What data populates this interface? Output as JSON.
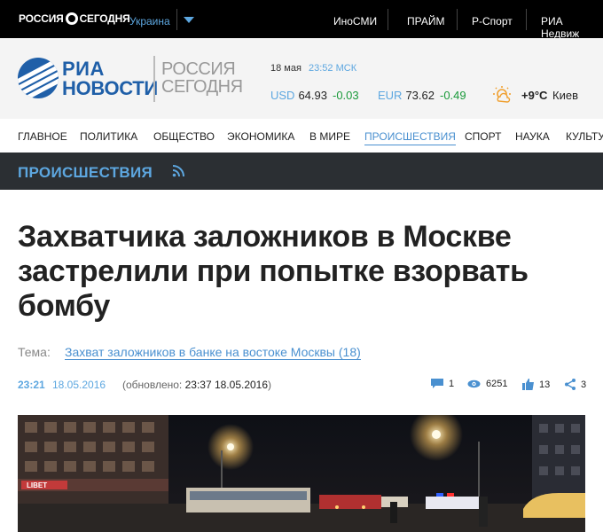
{
  "topbar": {
    "brand_left": "РОССИЯ",
    "brand_right": "СЕГОДНЯ",
    "region": "Украина",
    "links": [
      "ИноСМИ",
      "ПРАЙМ",
      "Р-Спорт",
      "РИА Недвиж"
    ]
  },
  "header": {
    "logo_ria": "РИА",
    "logo_novosti": "НОВОСТИ",
    "logo_rs_line1": "РОССИЯ",
    "logo_rs_line2": "СЕГОДНЯ",
    "date": "18 мая",
    "time": "23:52 МСК",
    "usd_label": "USD",
    "usd_value": "64.93",
    "usd_change": "-0.03",
    "eur_label": "EUR",
    "eur_value": "73.62",
    "eur_change": "-0.49",
    "temperature": "+9°C",
    "city": "Киев",
    "weather_icon": "cloud-sun-icon"
  },
  "nav": {
    "items": [
      "ГЛАВНОЕ",
      "ПОЛИТИКА",
      "ОБЩЕСТВО",
      "ЭКОНОМИКА",
      "В МИРЕ",
      "ПРОИСШЕСТВИЯ",
      "СПОРТ",
      "НАУКА",
      "КУЛЬТУ"
    ],
    "active": "ПРОИСШЕСТВИЯ"
  },
  "section": {
    "title": "ПРОИСШЕСТВИЯ"
  },
  "article": {
    "headline": "Захватчика заложников в Москве застрелили при попытке взорвать бомбу",
    "tema_label": "Тема:",
    "tema_link": "Захват заложников в банке на востоке Москвы (18)",
    "time": "23:21",
    "date": "18.05.2016",
    "updated_prefix": "(обновлено: ",
    "updated_value": "23:37 18.05.2016",
    "updated_suffix": ")",
    "comments": "1",
    "views": "6251",
    "likes": "13",
    "shares": "3"
  },
  "photo": {
    "sign_text": "LIBET"
  },
  "colors": {
    "accent_blue": "#5da7e0",
    "link_blue": "#4a90d0",
    "positive_green": "#1a9a3a",
    "brand_blue": "#1f5fa8",
    "section_bg": "#2b2f33"
  }
}
